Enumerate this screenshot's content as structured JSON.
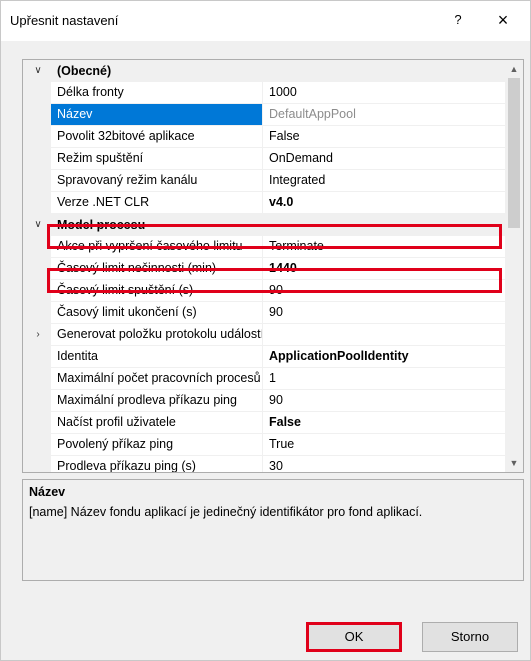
{
  "dialog": {
    "title": "Upřesnit nastavení",
    "help": "?",
    "close": "×"
  },
  "grid": {
    "rows": [
      {
        "type": "category",
        "toggle": "∨",
        "name": "(Obecné)"
      },
      {
        "type": "prop",
        "name": "Délka fronty",
        "value": "1000"
      },
      {
        "type": "prop",
        "name": "Název",
        "value": "DefaultAppPool",
        "selected": true,
        "value_style": "gray"
      },
      {
        "type": "prop",
        "name": "Povolit 32bitové aplikace",
        "value": "False"
      },
      {
        "type": "prop",
        "name": "Režim spuštění",
        "value": "OnDemand"
      },
      {
        "type": "prop",
        "name": "Spravovaný režim kanálu",
        "value": "Integrated"
      },
      {
        "type": "prop",
        "name": "Verze .NET CLR",
        "value": "v4.0",
        "value_style": "bold"
      },
      {
        "type": "category",
        "toggle": "∨",
        "name": "Model procesu",
        "highlighted": true
      },
      {
        "type": "prop",
        "name": "Akce při vypršení časového limitu",
        "value": "Terminate"
      },
      {
        "type": "prop",
        "name": "Časový limit nečinnosti (min)",
        "value": "1440",
        "value_style": "bold",
        "highlighted": true
      },
      {
        "type": "prop",
        "name": "Časový limit spuštění (s)",
        "value": "90"
      },
      {
        "type": "prop",
        "name": "Časový limit ukončení (s)",
        "value": "90"
      },
      {
        "type": "prop",
        "name": "Generovat položku protokolu událostí",
        "value": "",
        "toggle": "›"
      },
      {
        "type": "prop",
        "name": "Identita",
        "value": "ApplicationPoolIdentity",
        "value_style": "bold"
      },
      {
        "type": "prop",
        "name": "Maximální počet pracovních procesů",
        "value": "1"
      },
      {
        "type": "prop",
        "name": "Maximální prodleva příkazu ping",
        "value": "90"
      },
      {
        "type": "prop",
        "name": "Načíst profil uživatele",
        "value": "False",
        "value_style": "bold"
      },
      {
        "type": "prop",
        "name": "Povolený příkaz ping",
        "value": "True"
      },
      {
        "type": "prop",
        "name": "Prodleva příkazu ping (s)",
        "value": "30"
      }
    ]
  },
  "description": {
    "title": "Název",
    "text": "[name] Název fondu aplikací je jedinečný identifikátor pro fond aplikací."
  },
  "buttons": {
    "ok": "OK",
    "cancel": "Storno"
  },
  "colors": {
    "selection": "#0078d7",
    "highlight_box": "#e0001a"
  }
}
